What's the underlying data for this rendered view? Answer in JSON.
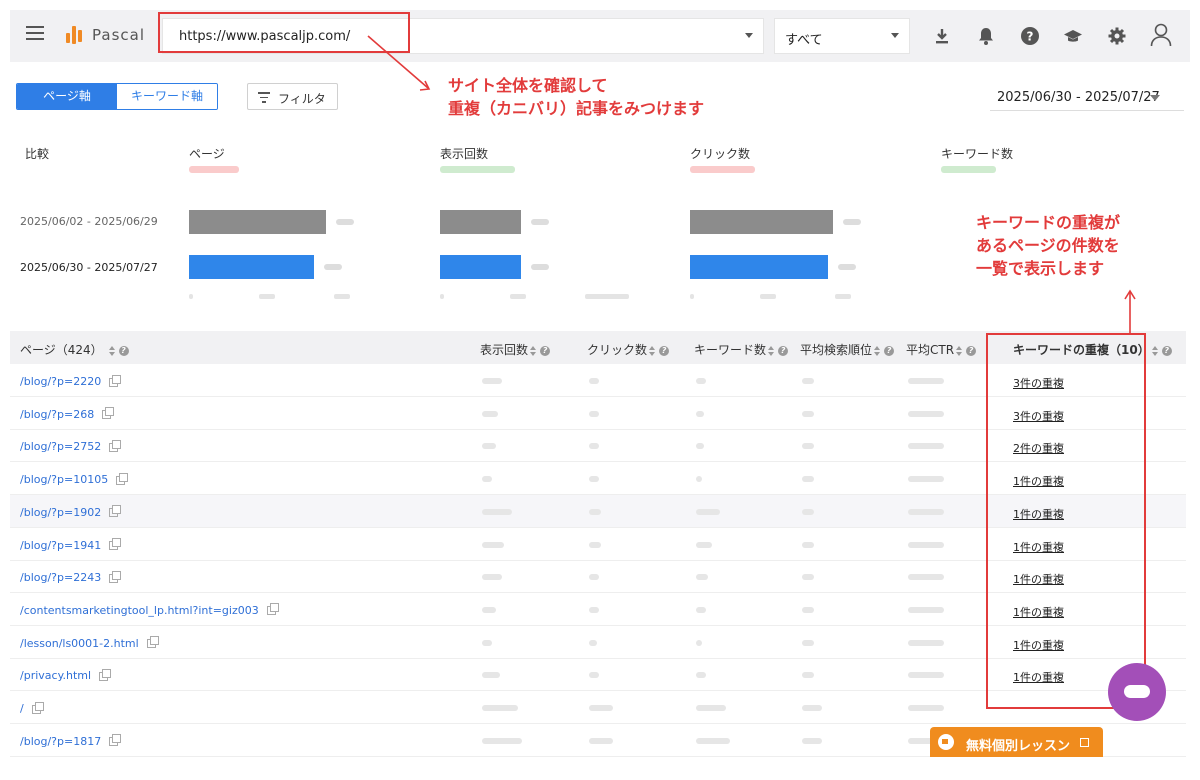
{
  "header": {
    "logo_text": "Pascal",
    "url_value": "https://www.pascaljp.com/",
    "scope_value": "すべて",
    "icons": [
      "download-icon",
      "bell-icon",
      "help-icon",
      "graduation-cap-icon",
      "gear-icon",
      "user-icon"
    ]
  },
  "toolbar": {
    "tab_page": "ページ軸",
    "tab_keyword": "キーワード軸",
    "filter_label": "フィルタ",
    "date_range": "2025/06/30 - 2025/07/27"
  },
  "comparison": {
    "label": "比較",
    "metrics": [
      "ページ",
      "表示回数",
      "クリック数",
      "キーワード数"
    ],
    "range_prev": "2025/06/02 - 2025/06/29",
    "range_cur": "2025/06/30 - 2025/07/27",
    "bars": [
      {
        "metric": "ページ",
        "prev": 0.93,
        "cur": 0.85
      },
      {
        "metric": "表示回数",
        "prev": 0.55,
        "cur": 0.55
      },
      {
        "metric": "クリック数",
        "prev": 0.97,
        "cur": 0.94
      }
    ]
  },
  "table": {
    "columns": [
      "ページ（424）",
      "表示回数",
      "クリック数",
      "キーワード数",
      "平均検索順位",
      "平均CTR",
      "キーワードの重複（10）"
    ],
    "rows": [
      {
        "page": "/blog/?p=2220",
        "dup": "3件の重複"
      },
      {
        "page": "/blog/?p=268",
        "dup": "3件の重複"
      },
      {
        "page": "/blog/?p=2752",
        "dup": "2件の重複"
      },
      {
        "page": "/blog/?p=10105",
        "dup": "1件の重複"
      },
      {
        "page": "/blog/?p=1902",
        "dup": "1件の重複"
      },
      {
        "page": "/blog/?p=1941",
        "dup": "1件の重複"
      },
      {
        "page": "/blog/?p=2243",
        "dup": "1件の重複"
      },
      {
        "page": "/contentsmarketingtool_lp.html?int=giz003",
        "dup": "1件の重複"
      },
      {
        "page": "/lesson/ls0001-2.html",
        "dup": "1件の重複"
      },
      {
        "page": "/privacy.html",
        "dup": "1件の重複"
      },
      {
        "page": "/",
        "dup": ""
      },
      {
        "page": "/blog/?p=1817",
        "dup": ""
      }
    ]
  },
  "annotations": {
    "top_line1": "サイト全体を確認して",
    "top_line2": "重複（カニバリ）記事をみつけます",
    "right_line1": "キーワードの重複が",
    "right_line2": "あるページの件数を",
    "right_line3": "一覧で表示します",
    "color": "#e23b3b"
  },
  "widgets": {
    "lesson_label": "無料個別レッスン"
  }
}
